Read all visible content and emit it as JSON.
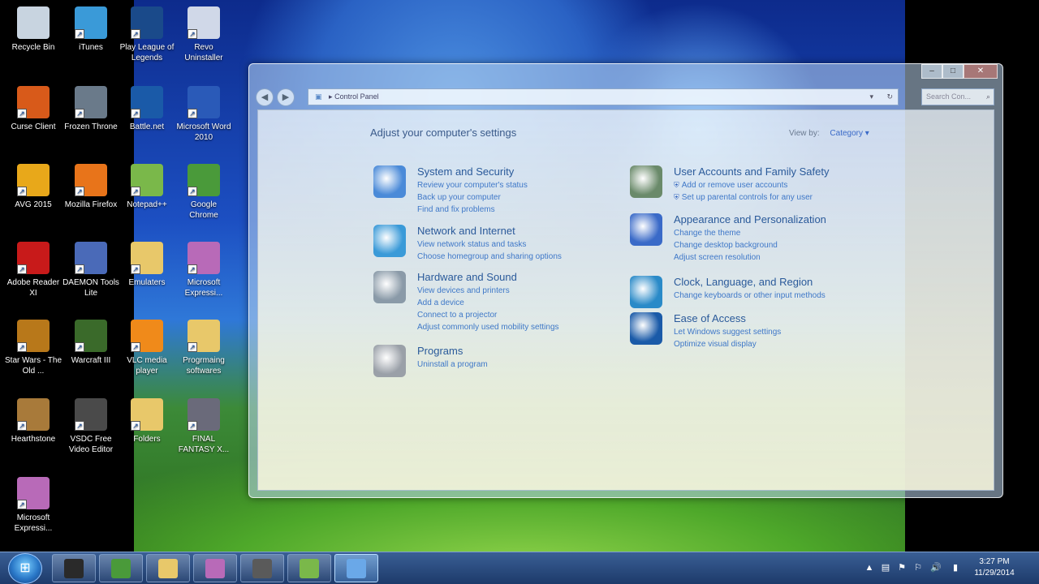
{
  "desktop": {
    "icons": [
      {
        "label": "Recycle Bin",
        "icon": "recycle-bin-icon",
        "color": "#c8d4e0"
      },
      {
        "label": "iTunes",
        "icon": "itunes-icon",
        "color": "#3a9ad8"
      },
      {
        "label": "Play League of Legends",
        "icon": "league-of-legends-icon",
        "color": "#1a4a8a"
      },
      {
        "label": "Revo Uninstaller",
        "icon": "revo-uninstaller-icon",
        "color": "#d0d8e8"
      },
      {
        "label": "Curse Client",
        "icon": "curse-client-icon",
        "color": "#d85a1a"
      },
      {
        "label": "Frozen Throne",
        "icon": "frozen-throne-icon",
        "color": "#6a7a8a"
      },
      {
        "label": "Battle.net",
        "icon": "battlenet-icon",
        "color": "#1a5aa8"
      },
      {
        "label": "Microsoft Word 2010",
        "icon": "word-icon",
        "color": "#2a5ab8"
      },
      {
        "label": "AVG 2015",
        "icon": "avg-icon",
        "color": "#e8a81a"
      },
      {
        "label": "Mozilla Firefox",
        "icon": "firefox-icon",
        "color": "#e8741a"
      },
      {
        "label": "Notepad++",
        "icon": "notepad-plus-plus-icon",
        "color": "#7ab84a"
      },
      {
        "label": "Google Chrome",
        "icon": "chrome-icon",
        "color": "#4a9a3a"
      },
      {
        "label": "Adobe Reader XI",
        "icon": "adobe-reader-icon",
        "color": "#c81a1a"
      },
      {
        "label": "DAEMON Tools Lite",
        "icon": "daemon-tools-icon",
        "color": "#4a6ab8"
      },
      {
        "label": "Emulaters",
        "icon": "folder-icon",
        "color": "#e8c86a"
      },
      {
        "label": "Microsoft Expressi...",
        "icon": "expression-encoder-icon",
        "color": "#b86ab8"
      },
      {
        "label": "Star Wars - The Old ...",
        "icon": "star-wars-icon",
        "color": "#b8781a"
      },
      {
        "label": "Warcraft III",
        "icon": "warcraft-icon",
        "color": "#3a6a2a"
      },
      {
        "label": "VLC media player",
        "icon": "vlc-icon",
        "color": "#f08a1a"
      },
      {
        "label": "Progrmaing softwares",
        "icon": "folder-doc-icon",
        "color": "#e8c86a"
      },
      {
        "label": "Hearthstone",
        "icon": "hearthstone-icon",
        "color": "#a87a3a"
      },
      {
        "label": "VSDC Free Video Editor",
        "icon": "vsdc-editor-icon",
        "color": "#4a4a4a"
      },
      {
        "label": "Folders",
        "icon": "folder-icon",
        "color": "#e8c86a"
      },
      {
        "label": "FINAL FANTASY X...",
        "icon": "final-fantasy-icon",
        "color": "#6a6a7a"
      },
      {
        "label": "Microsoft Expressi...",
        "icon": "expression-encoder-icon",
        "color": "#b86ab8"
      }
    ]
  },
  "window": {
    "controls": {
      "minimize": "–",
      "maximize": "□",
      "close": "✕"
    },
    "back_glyph": "◀",
    "forward_glyph": "▶",
    "address": "Control Panel",
    "address_separator": "▸",
    "address_dropdown": "▾",
    "refresh_glyph": "↻",
    "search_placeholder": "Search Con...",
    "search_glyph": "⌕",
    "title": "Adjust your computer's settings",
    "view_by_label": "View by:",
    "view_by_value": "Category ▾",
    "categories": [
      {
        "title": "System and Security",
        "icon": "system-security-icon",
        "color": "#4a8ad8",
        "links": [
          "Review your computer's status",
          "Back up your computer",
          "Find and fix problems"
        ]
      },
      {
        "title": "Network and Internet",
        "icon": "network-icon",
        "color": "#3a9ad8",
        "links": [
          "View network status and tasks",
          "Choose homegroup and sharing options"
        ]
      },
      {
        "title": "Hardware and Sound",
        "icon": "hardware-sound-icon",
        "color": "#8a9aa8",
        "links": [
          "View devices and printers",
          "Add a device",
          "Connect to a projector",
          "Adjust commonly used mobility settings"
        ]
      },
      {
        "title": "Programs",
        "icon": "programs-icon",
        "color": "#9aa0a8",
        "links": [
          "Uninstall a program"
        ]
      },
      {
        "title": "User Accounts and Family Safety",
        "icon": "user-accounts-icon",
        "color": "#6a8a6a",
        "links": [
          "Add or remove user accounts",
          "Set up parental controls for any user"
        ]
      },
      {
        "title": "Appearance and Personalization",
        "icon": "appearance-icon",
        "color": "#3a6ac8",
        "links": [
          "Change the theme",
          "Change desktop background",
          "Adjust screen resolution"
        ]
      },
      {
        "title": "Clock, Language, and Region",
        "icon": "clock-globe-icon",
        "color": "#2a8ac8",
        "links": [
          "Change keyboards or other input methods"
        ]
      },
      {
        "title": "Ease of Access",
        "icon": "ease-of-access-icon",
        "color": "#1a5aa8",
        "links": [
          "Let Windows suggest settings",
          "Optimize visual display"
        ]
      }
    ]
  },
  "taskbar": {
    "start_glyph": "⊞",
    "apps": [
      {
        "icon": "hp-icon",
        "color": "#2a2a2a"
      },
      {
        "icon": "chrome-icon",
        "color": "#4a9a3a"
      },
      {
        "icon": "explorer-folder-icon",
        "color": "#e8c86a"
      },
      {
        "icon": "expression-encoder-icon",
        "color": "#b86ab8"
      },
      {
        "icon": "vsdc-editor-icon",
        "color": "#5a5a5a"
      },
      {
        "icon": "notepad-plus-plus-icon",
        "color": "#7ab84a"
      },
      {
        "icon": "control-panel-icon",
        "color": "#6aa8e8"
      }
    ],
    "tray": {
      "time": "3:27 PM",
      "date": "11/29/2014",
      "icons": [
        "show-hidden-icons-icon",
        "network-tray-icon",
        "action-center-icon",
        "flag-icon",
        "volume-icon",
        "signal-icon"
      ]
    }
  }
}
